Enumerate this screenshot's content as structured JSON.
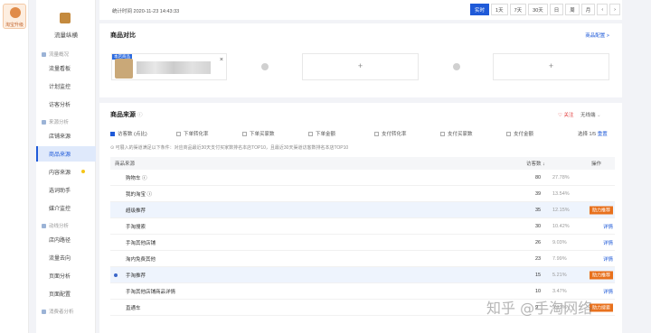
{
  "sidebar": {
    "logo_label": "淘宝升级"
  },
  "nav": {
    "module_title": "流量纵横",
    "sections": [
      {
        "title": "流量概况",
        "items": [
          "流量看板",
          "计划监控",
          "访客分析"
        ]
      },
      {
        "title": "来源分析",
        "items": [
          "店铺来源",
          "商品来源",
          "内容来源",
          "选词助手",
          "媒介监控"
        ]
      },
      {
        "title": "动线分析",
        "items": [
          "店内路径",
          "流量去向",
          "页面分析",
          "页面配置"
        ]
      },
      {
        "title": "消费者分析",
        "items": []
      }
    ],
    "active_item": "商品来源"
  },
  "topbar": {
    "time_label": "统计时间 2020-11-23 14:43:33",
    "date_buttons": [
      "实时",
      "1天",
      "7天",
      "30天",
      "日",
      "周",
      "月"
    ],
    "active_date": "实时",
    "prev_icon": "‹",
    "next_icon": "›"
  },
  "compare": {
    "title": "商品对比",
    "config_link": "商品配置 >",
    "product_tag": "本店商品",
    "close_glyph": "×",
    "plus_glyph": "+"
  },
  "source": {
    "title": "商品来源",
    "help_glyph": "ⓘ",
    "follow_label": "♡ 关注",
    "product_select": "无线端",
    "metrics": [
      "访客数 (点比)",
      "下单转化率",
      "下单买家数",
      "下单金额",
      "支付转化率",
      "支付买家数",
      "支付金额"
    ],
    "selected_info": "选择 1/5",
    "reset_label": "重置",
    "notice": "⊙ 可展入的渠道满足以下条件：对应商品最近30天支付买家数排名本店TOP10，且最近30天渠道访客数排名本店TOP10",
    "columns": {
      "source": "商品来源",
      "visitors": "访客数 ↓",
      "op": "操作"
    },
    "rows": [
      {
        "name": "购物车 ⓘ",
        "visitors": "80",
        "pct": "27.78%",
        "op": "",
        "op_type": "none"
      },
      {
        "name": "我的淘宝 ⓘ",
        "visitors": "39",
        "pct": "13.54%",
        "op": "",
        "op_type": "none"
      },
      {
        "name": "超级推荐",
        "visitors": "35",
        "pct": "12.15%",
        "op": "助力推荐",
        "op_type": "badge"
      },
      {
        "name": "手淘搜索",
        "visitors": "30",
        "pct": "10.42%",
        "op": "详情",
        "op_type": "link"
      },
      {
        "name": "手淘其他店铺",
        "visitors": "26",
        "pct": "9.03%",
        "op": "详情",
        "op_type": "link"
      },
      {
        "name": "淘内免费其他",
        "visitors": "23",
        "pct": "7.99%",
        "op": "详情",
        "op_type": "link"
      },
      {
        "name": "手淘推荐",
        "visitors": "15",
        "pct": "5.21%",
        "op": "助力推荐",
        "op_type": "badge"
      },
      {
        "name": "手淘其他店铺商品详情",
        "visitors": "10",
        "pct": "3.47%",
        "op": "详情",
        "op_type": "link"
      },
      {
        "name": "直通车",
        "visitors": "9",
        "pct": "3.13%",
        "op": "助力搜索",
        "op_type": "badge"
      }
    ]
  },
  "watermark": "知乎 @手淘网络"
}
